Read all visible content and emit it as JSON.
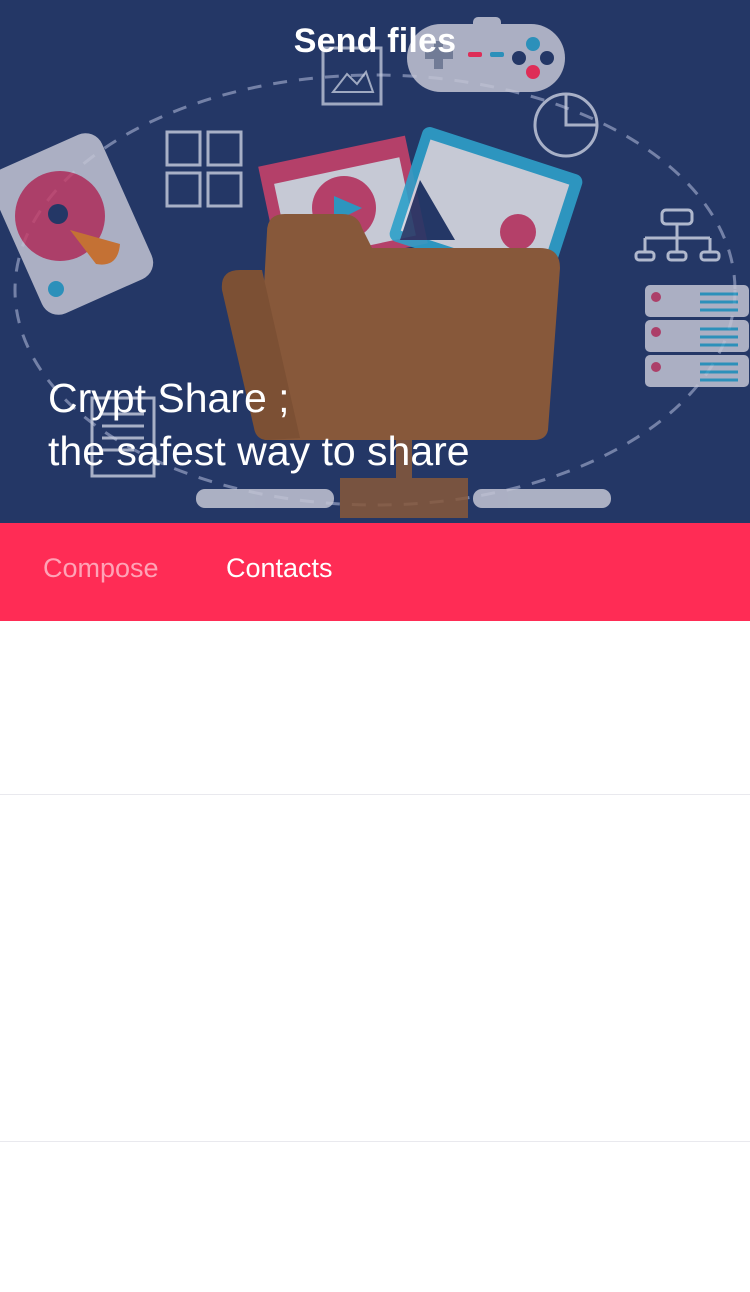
{
  "header": {
    "title": "Send files",
    "tagline_line1": "Crypt Share ;",
    "tagline_line2": "the safest way to share"
  },
  "tabs": [
    {
      "label": "Compose",
      "active": false
    },
    {
      "label": "Contacts",
      "active": true
    }
  ],
  "contacts": [
    {
      "name": ""
    },
    {
      "name": ""
    },
    {
      "name": ""
    }
  ],
  "colors": {
    "hero_bg": "#243766",
    "tab_bar": "#ff2c55",
    "tab_inactive_text": "#ffa3b6",
    "folder": "#87583a"
  }
}
